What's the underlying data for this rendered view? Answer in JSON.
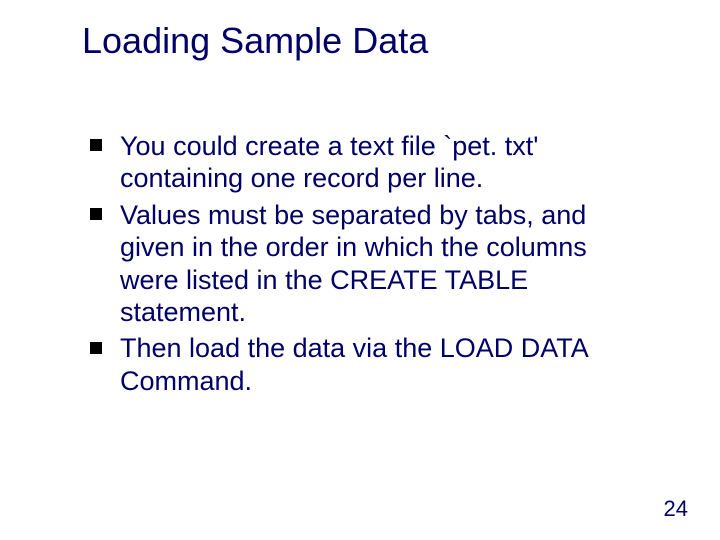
{
  "slide": {
    "title": "Loading Sample Data",
    "bullets": [
      "You could create a text file `pet. txt' containing one record per line.",
      "Values must be separated by tabs, and given in the order in which the columns were listed in the CREATE TABLE statement.",
      "Then load the data via the LOAD DATA Command."
    ],
    "page_number": "24"
  }
}
